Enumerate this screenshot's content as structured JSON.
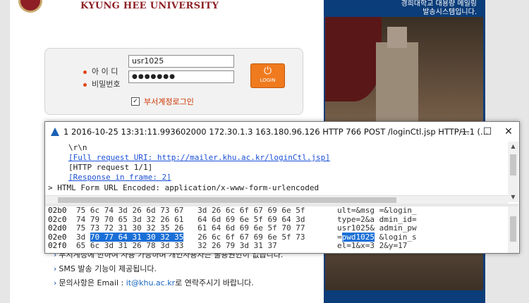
{
  "header": {
    "university": "KYUNG HEE UNIVERSITY"
  },
  "side_panel": {
    "caption_line1": "경희대학교 대용량 메일링",
    "caption_line2": "발송시스템입니다."
  },
  "login": {
    "id_label": "아 이 디",
    "pw_label": "비밀번호",
    "id_value": "usr1025",
    "pw_value": "●●●●●●●",
    "button_label": "LOGIN",
    "button_icon": "power-icon",
    "checkbox_label": "부서계정로그인",
    "checkbox_checked": true
  },
  "notices": [
    "부서계정에 한하여 사용 가능하며 개인사용자는 불용권한이 없습니다.",
    "SMS 발송 기능이 제공됩니다.",
    "문의사항은 Email : "
  ],
  "notice_email": "it@khu.ac.kr",
  "notice_email_suffix": "로 연락주시기 바랍니다.",
  "packet_window": {
    "title": "1 2016-10-25 13:31:11.993602000 172.30.1.3 163.180.96.126 HTTP 766 POST /loginCtl.jsp HTTP/1.1  (...",
    "minimize": "—",
    "maximize": "☐",
    "close": "✕",
    "tree": {
      "line1": "\\r\\n",
      "line2": "[Full request URI: http://mailer.khu.ac.kr/loginCtl.jsp]",
      "line3": "[HTTP request 1/1]",
      "line4": "[Response in frame: 2]",
      "line5": "HTML Form URL Encoded: application/x-www-form-urlencoded"
    },
    "hex_rows": [
      {
        "offset": "02b0",
        "hex": "75 6c 74 3d 26 6d 73 67   3d 26 6c 6f 67 69 6e 5f",
        "ascii": "ult=&msg =&login_"
      },
      {
        "offset": "02c0",
        "hex": "74 79 70 65 3d 32 26 61   64 6d 69 6e 5f 69 64 3d",
        "ascii": "type=2&a dmin_id="
      },
      {
        "offset": "02d0",
        "hex": "75 73 72 31 30 32 35 26   61 64 6d 69 6e 5f 70 77",
        "ascii": "usr1025& admin_pw"
      },
      {
        "offset": "02e0",
        "hex_pre": "3d ",
        "hex_sel": "70 77 64 31 30 32 35",
        "hex_post": "   26 6c 6f 67 69 6e 5f 73",
        "ascii_pre": "=",
        "ascii_sel": "pwd1025",
        "ascii_post": " &login_s"
      },
      {
        "offset": "02f0",
        "hex": "65 6c 3d 31 26 78 3d 33   32 26 79 3d 31 37",
        "ascii": "el=1&x=3 2&y=17"
      }
    ]
  }
}
